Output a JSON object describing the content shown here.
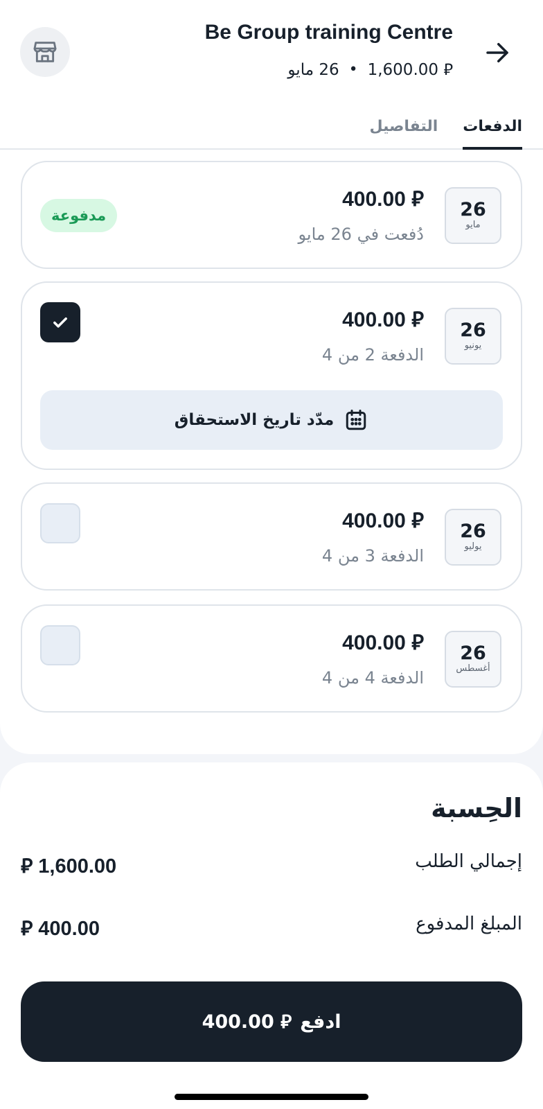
{
  "header": {
    "merchant": "Be Group training Centre",
    "total": "⃁ 1,600.00",
    "date": "26 مايو",
    "separator": "•"
  },
  "tabs": [
    {
      "label": "الدفعات",
      "active": true
    },
    {
      "label": "التفاصيل",
      "active": false
    }
  ],
  "installments": [
    {
      "day": "26",
      "month": "مايو",
      "amount": "⃁ 400.00",
      "subtext": "دُفعت في 26 مايو",
      "status": "paid",
      "badge": "مدفوعة"
    },
    {
      "day": "26",
      "month": "يونيو",
      "amount": "⃁ 400.00",
      "subtext": "الدفعة 2 من 4",
      "status": "selected",
      "extend_label": "مدّد تاريخ الاستحقاق"
    },
    {
      "day": "26",
      "month": "يوليو",
      "amount": "⃁ 400.00",
      "subtext": "الدفعة 3 من 4",
      "status": "unselected"
    },
    {
      "day": "26",
      "month": "أغسطس",
      "amount": "⃁ 400.00",
      "subtext": "الدفعة 4 من 4",
      "status": "unselected"
    }
  ],
  "bill": {
    "title": "الحِسبة",
    "rows": [
      {
        "label": "إجمالي الطلب",
        "value": "⃁ 1,600.00"
      },
      {
        "label": "المبلغ المدفوع",
        "value": "⃁ 400.00"
      }
    ]
  },
  "pay_button": {
    "label": "ادفع",
    "amount": "⃁ 400.00"
  },
  "colors": {
    "accent": "#17202b",
    "paid_badge_bg": "#d7f8e3",
    "paid_badge_text": "#1a9a56",
    "muted": "#7a8490"
  },
  "icons": {
    "store": "store-icon",
    "back": "arrow-right-icon",
    "check": "check-icon",
    "calendar": "calendar-icon"
  }
}
